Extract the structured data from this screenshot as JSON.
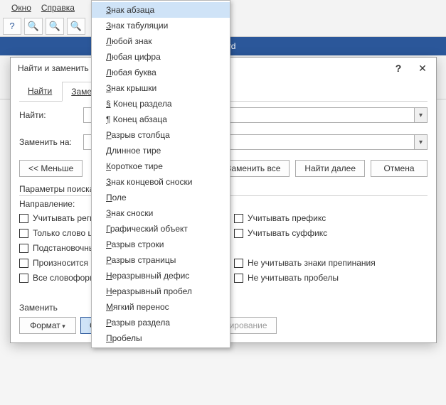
{
  "menubar": {
    "items": [
      "Окно",
      "Справка"
    ]
  },
  "toolbar_icons": [
    "?",
    "🔍",
    "🔍",
    "🔍"
  ],
  "titlebar": {
    "doc_suffix": " - Word"
  },
  "dialog": {
    "title": "Найти и заменить",
    "help": "?",
    "close": "✕",
    "tabs": [
      "Найти",
      "Заменить"
    ],
    "active_tab": 1,
    "find_label": "Найти:",
    "replace_label": "Заменить на:",
    "buttons": {
      "less": "<<  Меньше",
      "replace_all": "Заменить все",
      "find_next": "Найти далее",
      "cancel": "Отмена"
    },
    "params_label": "Параметры поиска",
    "direction_label": "Направление:",
    "checks_left": [
      "Учитывать регистр",
      "Только слово целиком",
      "Подстановочные знаки",
      "Произносится как",
      "Все словоформы"
    ],
    "checks_right_top": [
      "Учитывать префикс",
      "Учитывать суффикс"
    ],
    "checks_right_bottom": [
      "Не учитывать знаки препинания",
      "Не учитывать пробелы"
    ],
    "bottom_label": "Заменить",
    "format_btn": "Формат",
    "special_btn": "Специальный",
    "clear_fmt_btn": "Снять форматирование"
  },
  "special_menu": [
    "Знак абзаца",
    "Знак табуляции",
    "Любой знак",
    "Любая цифра",
    "Любая буква",
    "Знак крышки",
    "§ Конец раздела",
    "¶ Конец абзаца",
    "Разрыв столбца",
    "Длинное тире",
    "Короткое тире",
    "Знак концевой сноски",
    "Поле",
    "Знак сноски",
    "Графический объект",
    "Разрыв строки",
    "Разрыв страницы",
    "Неразрывный дефис",
    "Неразрывный пробел",
    "Мягкий перенос",
    "Разрыв раздела",
    "Пробелы"
  ],
  "special_menu_hover": 0
}
